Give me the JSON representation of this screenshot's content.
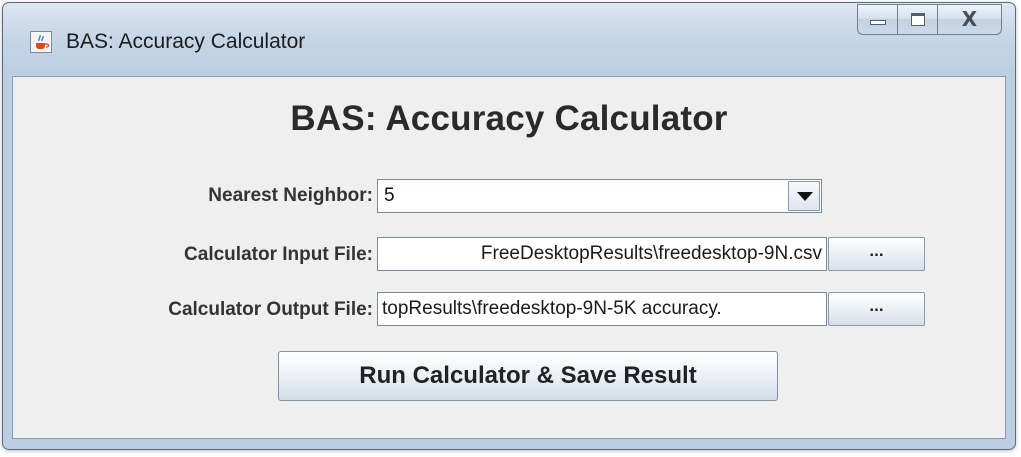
{
  "window": {
    "title": "BAS: Accuracy Calculator",
    "icon": "java-cup-icon",
    "controls": {
      "minimize": "minimize-icon",
      "maximize": "maximize-icon",
      "close": "X"
    }
  },
  "form": {
    "heading": "BAS: Accuracy Calculator",
    "nearest_neighbor": {
      "label": "Nearest Neighbor:",
      "value": "5"
    },
    "input_file": {
      "label": "Calculator Input File:",
      "value": "FreeDesktopResults\\freedesktop-9N.csv",
      "browse_label": "..."
    },
    "output_file": {
      "label": "Calculator Output File:",
      "value": "topResults\\freedesktop-9N-5K accuracy.",
      "browse_label": "..."
    },
    "run_label": "Run Calculator & Save Result"
  },
  "colors": {
    "window_frame": "#bccee2",
    "client_bg": "#efefef",
    "text": "#333333"
  }
}
